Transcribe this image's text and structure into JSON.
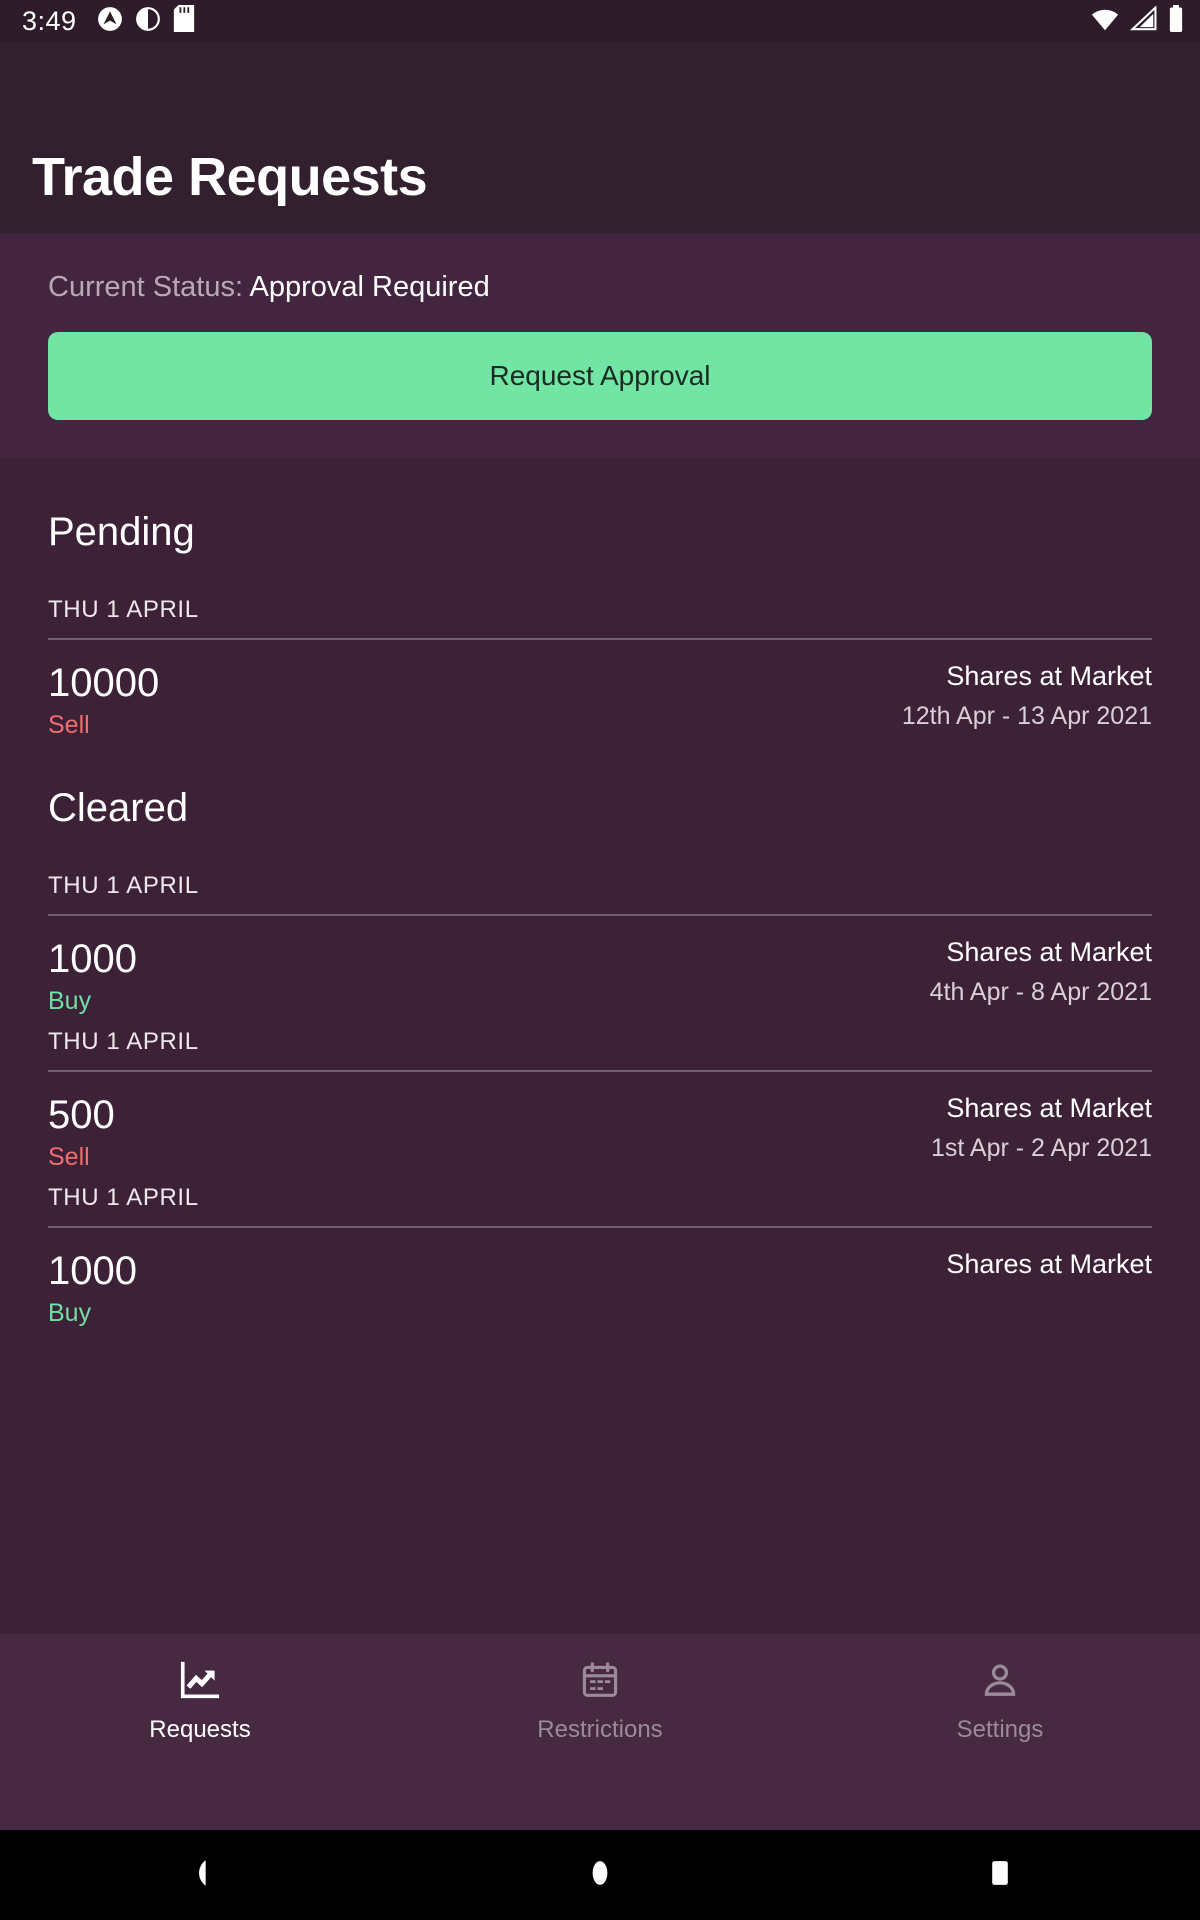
{
  "status_bar": {
    "time": "3:49",
    "left_icons": [
      "caret-circle-icon",
      "contrast-circle-icon",
      "sd-card-icon"
    ],
    "right_icons": [
      "wifi-icon",
      "cell-signal-icon",
      "battery-icon"
    ]
  },
  "app_bar": {
    "title": "Trade Requests"
  },
  "status_card": {
    "label": "Current Status:",
    "value": "Approval Required",
    "button_label": "Request Approval",
    "button_color": "#72e5a5"
  },
  "sections": [
    {
      "title": "Pending",
      "groups": [
        {
          "day": "THU 1 APRIL",
          "rows": [
            {
              "quantity": "10000",
              "side": "Sell",
              "side_color": "#ef6f6f",
              "type": "Shares at Market",
              "dates": "12th Apr - 13 Apr 2021"
            }
          ]
        }
      ]
    },
    {
      "title": "Cleared",
      "groups": [
        {
          "day": "THU 1 APRIL",
          "rows": [
            {
              "quantity": "1000",
              "side": "Buy",
              "side_color": "#6fe0a4",
              "type": "Shares at Market",
              "dates": "4th Apr - 8 Apr 2021"
            }
          ]
        },
        {
          "day": "THU 1 APRIL",
          "rows": [
            {
              "quantity": "500",
              "side": "Sell",
              "side_color": "#ef6f6f",
              "type": "Shares at Market",
              "dates": "1st Apr - 2 Apr 2021"
            }
          ]
        },
        {
          "day": "THU 1 APRIL",
          "rows": [
            {
              "quantity": "1000",
              "side": "Buy",
              "side_color": "#6fe0a4",
              "type": "Shares at Market",
              "dates": ""
            }
          ]
        }
      ]
    }
  ],
  "bottom_nav": {
    "items": [
      {
        "label": "Requests",
        "icon": "trending-chart-icon",
        "active": true
      },
      {
        "label": "Restrictions",
        "icon": "calendar-icon",
        "active": false
      },
      {
        "label": "Settings",
        "icon": "person-icon",
        "active": false
      }
    ]
  },
  "system_nav": {
    "back": "back-triangle-icon",
    "home": "home-circle-icon",
    "recents": "recents-square-icon"
  },
  "theme": {
    "statusbar_bg": "#2e1c2a",
    "appbar_bg": "#32202e",
    "status_section_bg": "#432540",
    "list_bg": "#3d2136",
    "bottomnav_bg": "#472a41",
    "accent": "#72e5a5",
    "sell": "#ef6f6f",
    "buy": "#6fe0a4"
  }
}
